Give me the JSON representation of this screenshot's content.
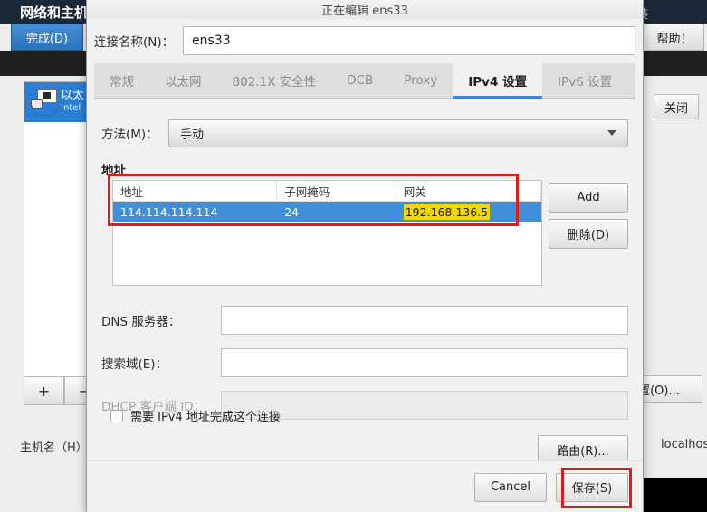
{
  "background": {
    "window_title": "网络和主机",
    "done_button": "完成(D)",
    "help_button": "帮助！",
    "install_text": "安装",
    "close_button": "关闭",
    "device": {
      "name": "以太",
      "vendor": "Intel"
    },
    "add_button": "+",
    "remove_button": "−",
    "configure_button": "置(O)...",
    "hostname_label": "主机名（H）",
    "hostname_colon": ":",
    "hostname_value": "localhost"
  },
  "dialog": {
    "title": "正在编辑 ens33",
    "connection_name_label": "连接名称(N)：",
    "connection_name_value": "ens33",
    "tabs": [
      {
        "label": "常规",
        "active": false
      },
      {
        "label": "以太网",
        "active": false
      },
      {
        "label": "802.1X 安全性",
        "active": false
      },
      {
        "label": "DCB",
        "active": false
      },
      {
        "label": "Proxy",
        "active": false
      },
      {
        "label": "IPv4 设置",
        "active": true
      },
      {
        "label": "IPv6 设置",
        "active": false
      }
    ],
    "method_label": "方法(M)：",
    "method_value": "手动",
    "addresses_title": "地址",
    "table": {
      "columns": [
        "地址",
        "子网掩码",
        "网关"
      ],
      "rows": [
        {
          "address": "114.114.114.114",
          "netmask": "24",
          "gateway": "192.168.136.5"
        }
      ]
    },
    "add_button": "Add",
    "delete_button": "删除(D)",
    "dns_label": "DNS 服务器：",
    "dns_value": "",
    "search_label": "搜索域(E)：",
    "search_value": "",
    "dhcp_label": "DHCP 客户端 ID：",
    "dhcp_value": "",
    "require_ipv4_label": "需要 IPv4 地址完成这个连接",
    "routes_button": "路由(R)...",
    "cancel_button": "Cancel",
    "save_button": "保存(S)"
  },
  "colors": {
    "accent_blue": "#3a86d0",
    "selection_blue": "#3f8fd9",
    "highlight_yellow": "#f5d800",
    "annotation_red": "#e01b1b",
    "titlebar_dark": "#1b2838"
  }
}
